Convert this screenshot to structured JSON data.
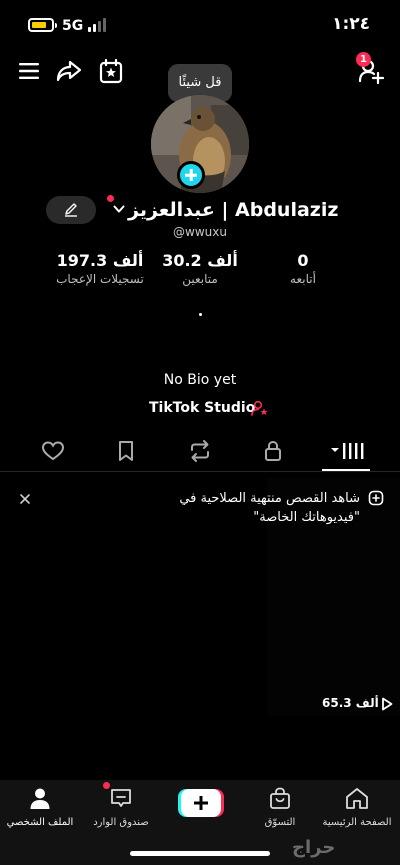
{
  "status_bar": {
    "network": "5G",
    "time": "١:٢٤"
  },
  "top_bar": {
    "tooltip": "قل شيئًا",
    "notification_count": "1"
  },
  "profile": {
    "name": "عبدالعزيز | Abdulaziz",
    "handle": "@wwuxu",
    "stats": [
      {
        "value": "0",
        "label": "أتابعه"
      },
      {
        "value": "30.2 ألف",
        "label": "متابعين"
      },
      {
        "value": "197.3 ألف",
        "label": "تسجيلات الإعجاب"
      }
    ],
    "bio": "No Bio yet",
    "studio_label": "TikTok Studio"
  },
  "tabs": [
    "videos",
    "private",
    "reposts",
    "favorites",
    "liked"
  ],
  "banner": {
    "text": "شاهد القصص منتهية الصلاحية في \"فيديوهاتك الخاصة\""
  },
  "video": {
    "views": "65.3 ألف"
  },
  "bottom_nav": {
    "home": "الصفحة الرئيسية",
    "shop": "التسوّق",
    "inbox": "صندوق الوارد",
    "profile": "الملف الشخصي"
  },
  "watermark": "حراج",
  "colors": {
    "accent": "#fe2c55",
    "cyan": "#25f4ee",
    "badge_plus": "#20d5ec"
  }
}
